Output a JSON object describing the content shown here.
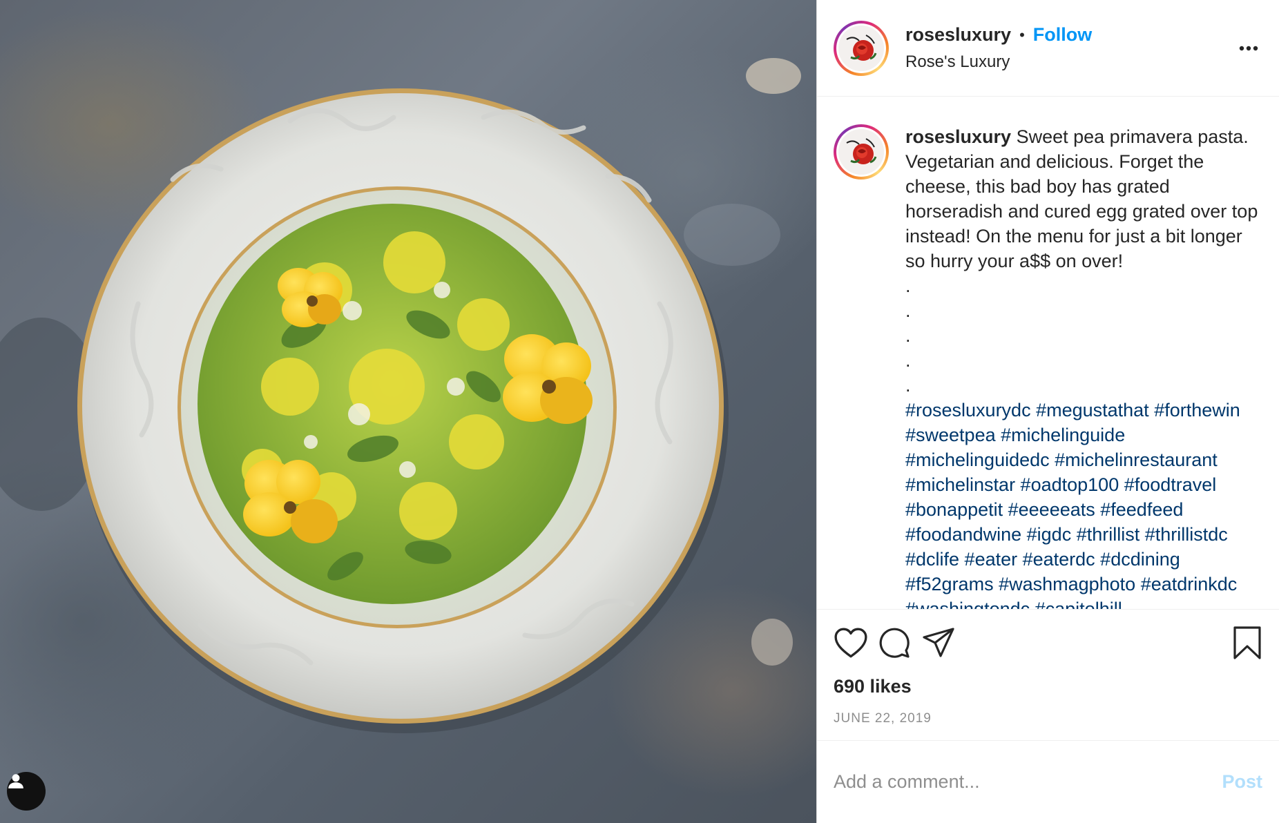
{
  "post": {
    "username": "rosesluxury",
    "separator": "•",
    "follow_label": "Follow",
    "location": "Rose's Luxury",
    "caption": {
      "username": "rosesluxury",
      "text": "Sweet pea primavera pasta. Vegetarian and delicious. Forget the cheese, this bad boy has grated horseradish and cured egg grated over top instead! On the menu for just a bit longer so hurry your a$$ on over!",
      "dots": ".\n.\n.\n.\n.",
      "hashtags": "#rosesluxurydc #megustathat #forthewin #sweetpea #michelinguide #michelinguidedc #michelinrestaurant #michelinstar #oadtop100 #foodtravel #bonappetit #eeeeeats #feedfeed #foodandwine #igdc #thrillist #thrillistdc #dclife #eater #eaterdc #dcdining #f52grams #washmagphoto #eatdrinkdc #washingtondc #capitolhill"
    },
    "likes": "690 likes",
    "date": "JUNE 22, 2019",
    "comment_placeholder": "Add a comment...",
    "post_label": "Post"
  },
  "icons": {
    "more": "more-options-icon",
    "like": "heart-icon",
    "comment": "comment-icon",
    "share": "paper-plane-icon",
    "save": "bookmark-icon",
    "tag": "user-icon"
  },
  "colors": {
    "follow": "#0095f6",
    "hashtag": "#00376b",
    "post_disabled": "#b2dffc",
    "muted": "#8e8e8e"
  }
}
